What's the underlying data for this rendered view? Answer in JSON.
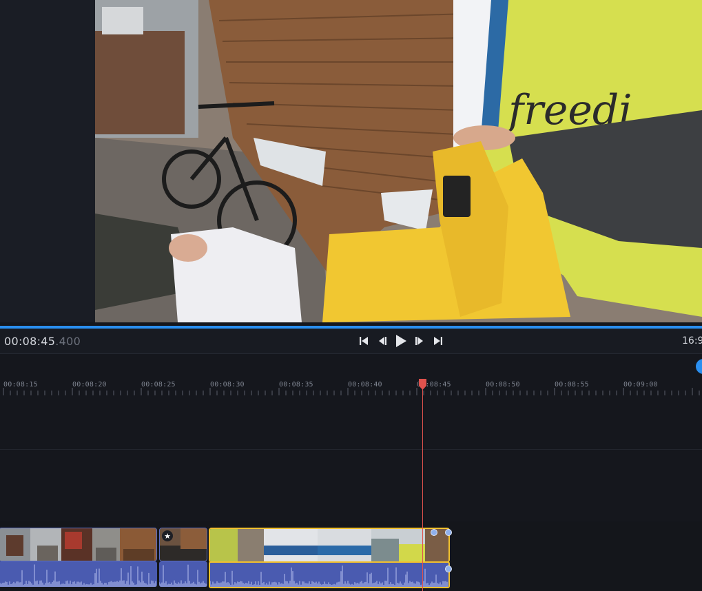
{
  "player": {
    "timecode_main": "00:08:45",
    "timecode_ms": ".400",
    "aspect_ratio": "16:9"
  },
  "transport": {
    "buttons": [
      "skip-to-start-icon",
      "step-back-icon",
      "play-icon",
      "step-forward-icon",
      "skip-to-end-icon"
    ]
  },
  "ruler": {
    "labels": [
      "00:08:15",
      "00:08:20",
      "00:08:25",
      "00:08:30",
      "00:08:35",
      "00:08:40",
      "00:08:45",
      "00:08:50",
      "00:08:55",
      "00:09:00"
    ],
    "playhead_time": "00:08:45.400"
  },
  "colors": {
    "accent": "#2a8ff0",
    "playhead": "#e0524d",
    "selection": "#f2c12e",
    "audio_track": "#4a5bb0"
  },
  "clips": {
    "badge_icon": "star-icon"
  }
}
